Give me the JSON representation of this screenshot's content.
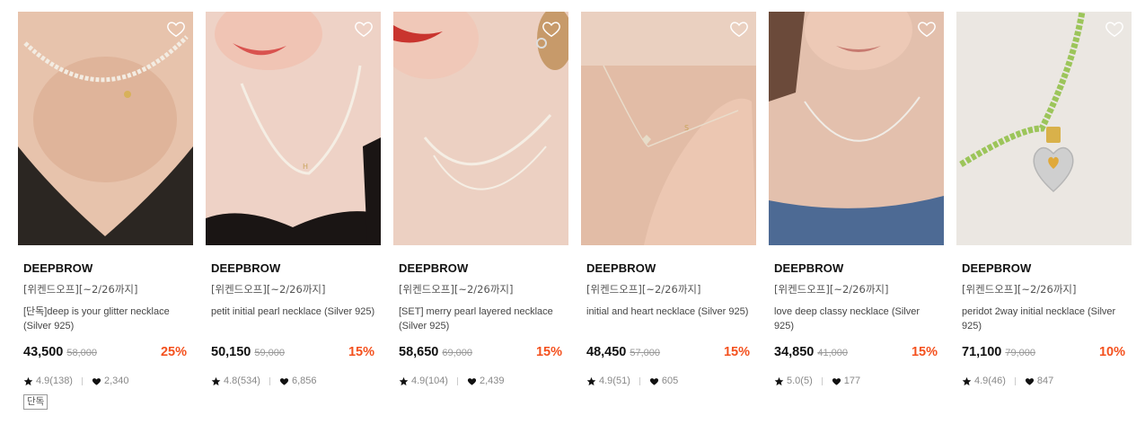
{
  "products": [
    {
      "brand": "DEEPBROW",
      "promo": "[위켄드오프][~2/26까지]",
      "name": "[단독]deep is your glitter necklace (Silver 925)",
      "price": "43,500",
      "original_price": "58,000",
      "discount": "25%",
      "rating": "4.9(138)",
      "likes": "2,340",
      "badge": "단독",
      "wishlisted": false
    },
    {
      "brand": "DEEPBROW",
      "promo": "[위켄드오프][~2/26까지]",
      "name": "petit initial pearl necklace (Silver 925)",
      "price": "50,150",
      "original_price": "59,000",
      "discount": "15%",
      "rating": "4.8(534)",
      "likes": "6,856",
      "wishlisted": false
    },
    {
      "brand": "DEEPBROW",
      "promo": "[위켄드오프][~2/26까지]",
      "name": "[SET] merry pearl layered necklace (Silver 925)",
      "price": "58,650",
      "original_price": "69,000",
      "discount": "15%",
      "rating": "4.9(104)",
      "likes": "2,439",
      "wishlisted": false
    },
    {
      "brand": "DEEPBROW",
      "promo": "[위켄드오프][~2/26까지]",
      "name": "initial and heart necklace (Silver 925)",
      "price": "48,450",
      "original_price": "57,000",
      "discount": "15%",
      "rating": "4.9(51)",
      "likes": "605",
      "wishlisted": false
    },
    {
      "brand": "DEEPBROW",
      "promo": "[위켄드오프][~2/26까지]",
      "name": "love deep classy necklace (Silver 925)",
      "price": "34,850",
      "original_price": "41,000",
      "discount": "15%",
      "rating": "5.0(5)",
      "likes": "177",
      "wishlisted": false
    },
    {
      "brand": "DEEPBROW",
      "promo": "[위켄드오프][~2/26까지]",
      "name": "peridot 2way initial necklace (Silver 925)",
      "price": "71,100",
      "original_price": "79,000",
      "discount": "10%",
      "rating": "4.9(46)",
      "likes": "847",
      "wishlisted": false
    }
  ],
  "icons": {
    "wishlist": "heart-outline-icon",
    "rating": "star-icon",
    "likes": "heart-filled-icon"
  },
  "colors": {
    "discount": "#f4511e",
    "price": "#111111",
    "original_price": "#999999"
  }
}
